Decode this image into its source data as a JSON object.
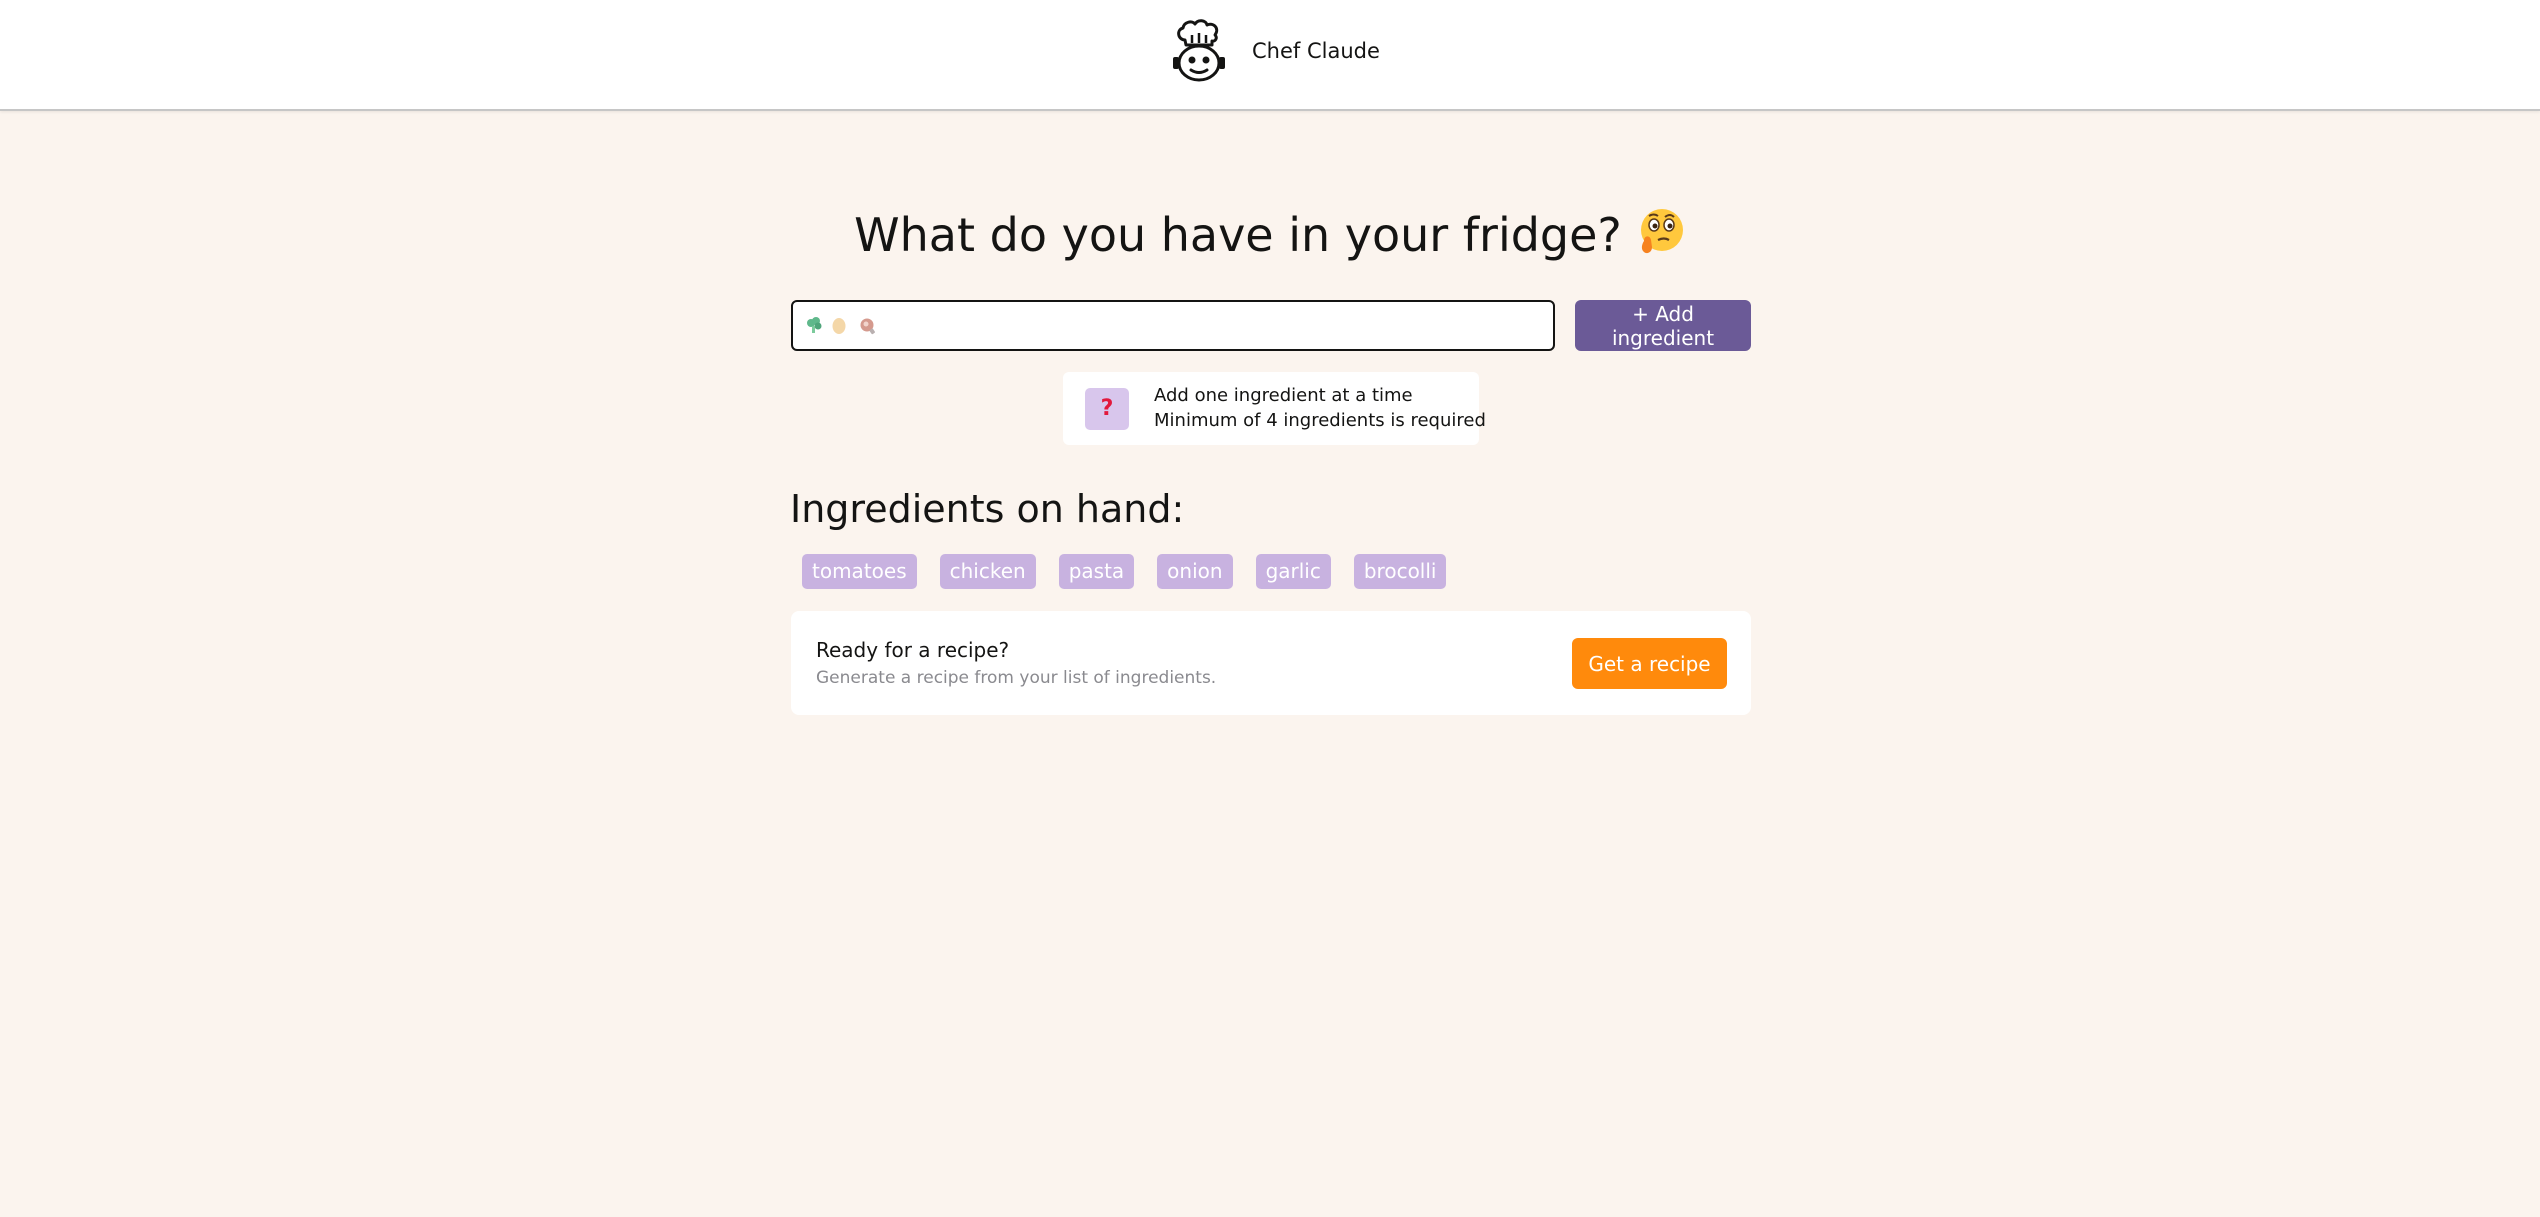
{
  "header": {
    "logo_icon": "chef-robot-icon",
    "brand": "Chef Claude"
  },
  "main": {
    "headline": "What do you have in your fridge?",
    "headline_emoji": "thinking-face-emoji",
    "input": {
      "value": "",
      "placeholder_icons": [
        "broccoli-icon",
        "egg-icon",
        "meat-icon"
      ]
    },
    "add_button_label": "+ Add ingredient",
    "hint": {
      "icon": "question-mark-icon",
      "icon_glyph": "?",
      "line1": "Add one ingredient at a time",
      "line2": "Minimum of 4 ingredients is required"
    },
    "ingredients_title": "Ingredients on hand:",
    "ingredients": [
      "tomatoes",
      "chicken",
      "pasta",
      "onion",
      "garlic",
      "brocolli"
    ],
    "recipe_card": {
      "title": "Ready for a recipe?",
      "subtitle": "Generate a recipe from your list of ingredients.",
      "button_label": "Get a recipe"
    }
  },
  "colors": {
    "page_background": "#FBF4EE",
    "add_button": "#6B5A97",
    "chip": "#C8B2E0",
    "recipe_button": "#FF8A0C"
  }
}
